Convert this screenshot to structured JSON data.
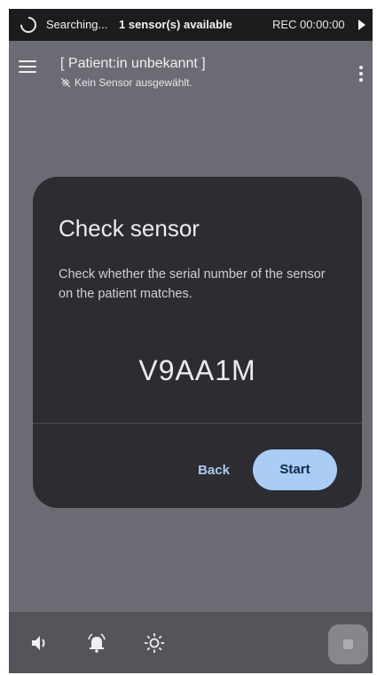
{
  "status_bar": {
    "searching": "Searching...",
    "sensor_count": "1 sensor(s) available",
    "rec_time": "REC 00:00:00"
  },
  "app_bar": {
    "title": "[ Patient:in unbekannt ]",
    "subtitle": "Kein Sensor ausgewählt."
  },
  "dialog": {
    "title": "Check sensor",
    "body": "Check whether the serial number of the sensor on the patient matches.",
    "serial": "V9AA1M",
    "back_label": "Back",
    "start_label": "Start"
  },
  "bottom_bar": {
    "icons": [
      "volume-icon",
      "alarm-bell-icon",
      "brightness-icon",
      "stop-icon"
    ]
  },
  "colors": {
    "background": "#6b6c73",
    "status_bar": "#1c1c1e",
    "dialog": "#2c2c31",
    "accent": "#a9cdf5",
    "bottom_bar": "#54555b"
  }
}
